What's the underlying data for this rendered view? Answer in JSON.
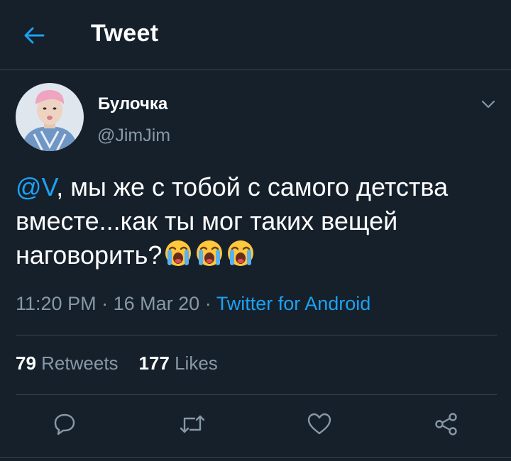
{
  "header": {
    "title": "Tweet",
    "back_icon": "arrow-left-icon"
  },
  "author": {
    "display_name": "Булочка",
    "handle": "@JimJim"
  },
  "tweet": {
    "mention": "@V",
    "text": ", мы же с тобой с самого детства вместе...как ты мог таких вещей наговорить?",
    "emoji_count": 3,
    "emoji_name": "loudly-crying-face-emoji"
  },
  "meta": {
    "time": "11:20 PM",
    "separator": "·",
    "date": "16 Mar 20",
    "source": "Twitter for Android"
  },
  "stats": {
    "retweets_count": "79",
    "retweets_label": "Retweets",
    "likes_count": "177",
    "likes_label": "Likes"
  },
  "actions": [
    "reply-icon",
    "retweet-icon",
    "like-icon",
    "share-icon"
  ],
  "colors": {
    "background": "#15202b",
    "accent": "#1da1f2",
    "secondary_text": "#8899a6",
    "divider": "#38444d"
  }
}
